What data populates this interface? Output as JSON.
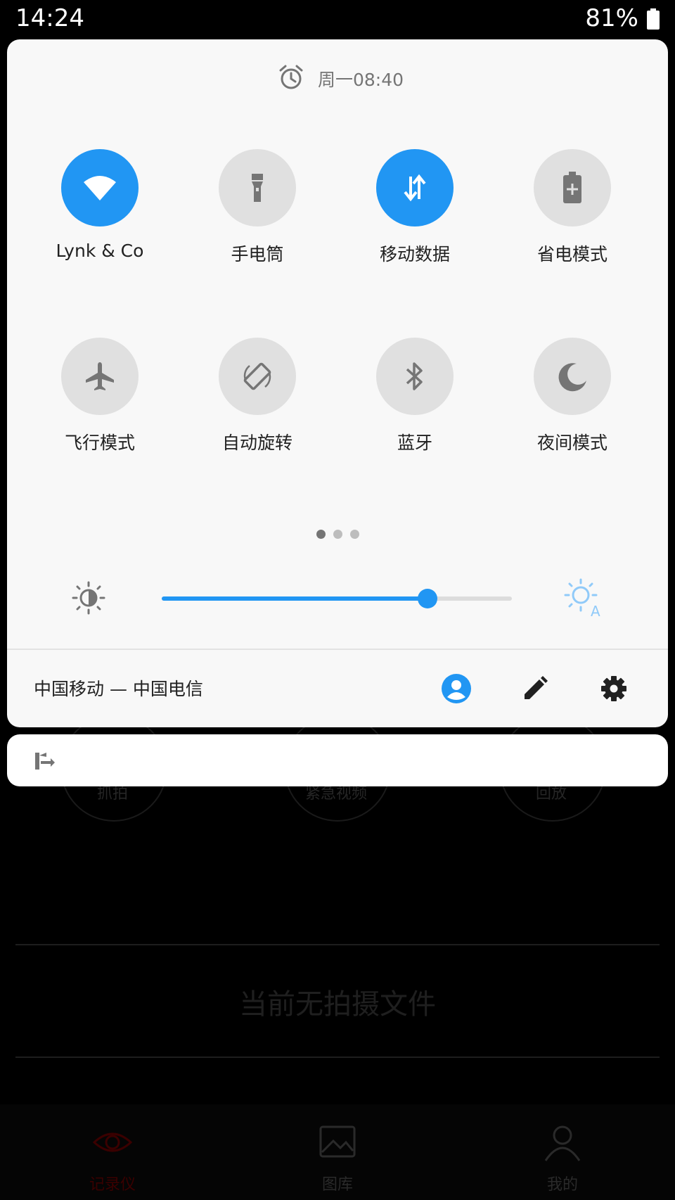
{
  "status_bar": {
    "time": "14:24",
    "battery": "81%"
  },
  "alarm": {
    "text": "周一08:40",
    "icon": "alarm-clock-icon"
  },
  "tiles": [
    {
      "label": "Lynk & Co",
      "icon": "wifi-icon",
      "on": true
    },
    {
      "label": "手电筒",
      "icon": "flashlight-icon",
      "on": false
    },
    {
      "label": "移动数据",
      "icon": "mobile-data-icon",
      "on": true
    },
    {
      "label": "省电模式",
      "icon": "battery-saver-icon",
      "on": false
    },
    {
      "label": "飞行模式",
      "icon": "airplane-icon",
      "on": false
    },
    {
      "label": "自动旋转",
      "icon": "auto-rotate-icon",
      "on": false
    },
    {
      "label": "蓝牙",
      "icon": "bluetooth-icon",
      "on": false
    },
    {
      "label": "夜间模式",
      "icon": "night-mode-icon",
      "on": false
    }
  ],
  "pages": {
    "count": 3,
    "current": 1
  },
  "brightness": {
    "level": 0.76
  },
  "footer": {
    "carrier": "中国移动 — 中国电信",
    "buttons": [
      "user-icon",
      "edit-icon",
      "settings-icon"
    ]
  },
  "notification": {
    "icon": "usb-share-icon"
  },
  "background_app": {
    "actions": [
      "抓拍",
      "紧急视频",
      "回放"
    ],
    "empty_text": "当前无拍摄文件",
    "tabs": [
      "记录仪",
      "图库",
      "我的"
    ]
  },
  "colors": {
    "accent": "#2196f3",
    "tile_off": "#e0e0e0",
    "panel": "#f8f8f8"
  }
}
